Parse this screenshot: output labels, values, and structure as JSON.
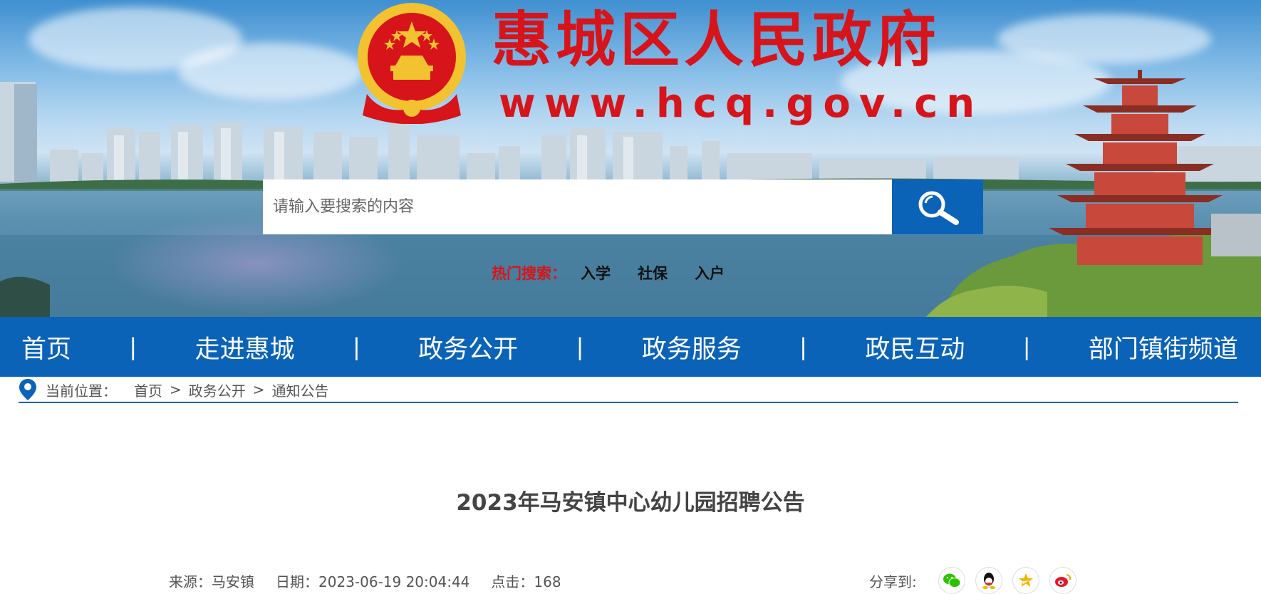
{
  "header": {
    "site_title": "惠城区人民政府",
    "site_url": "www.hcq.gov.cn",
    "emblem_icon": "national-emblem-icon",
    "title_color": "#d7141a"
  },
  "search": {
    "placeholder": "请输入要搜索的内容",
    "button_icon": "search-icon",
    "hot_label": "热门搜索：",
    "hot_items": [
      "入学",
      "社保",
      "入户"
    ]
  },
  "nav": {
    "items": [
      "首页",
      "走进惠城",
      "政务公开",
      "政务服务",
      "政民互动",
      "部门镇街频道"
    ],
    "separator": "|",
    "background": "#0b63b8"
  },
  "breadcrumb": {
    "icon": "location-pin-icon",
    "label": "当前位置：",
    "items": [
      "首页",
      "政务公开",
      "通知公告"
    ],
    "separator": ">"
  },
  "article": {
    "title": "2023年马安镇中心幼儿园招聘公告",
    "source": "来源：马安镇",
    "date": "日期：2023-06-19 20:04:44",
    "clicks": "点击：168",
    "share_label": "分享到:",
    "share_icons": [
      "wechat-icon",
      "qq-icon",
      "qzone-icon",
      "weibo-icon"
    ]
  }
}
